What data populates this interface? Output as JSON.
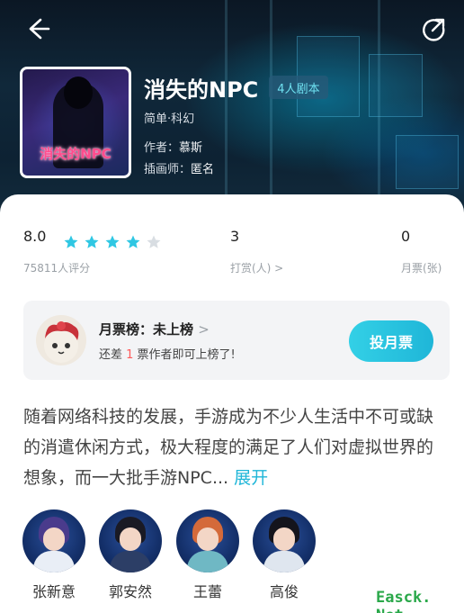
{
  "header": {
    "back_icon": "arrow-left-icon",
    "share_icon": "share-icon",
    "cover_title": "消失的NPC",
    "title": "消失的NPC",
    "tag": "4人剧本",
    "genre": "简单·科幻",
    "author_label": "作者：",
    "author": "慕斯",
    "illustrator_label": "插画师：",
    "illustrator": "匿名"
  },
  "stats": {
    "rating": "8.0",
    "stars_filled": 4,
    "stars_total": 5,
    "rating_count": "75811人评分",
    "tips": "3",
    "tips_label": "打赏(人) >",
    "tickets": "0",
    "tickets_label": "月票(张)"
  },
  "ticket_card": {
    "title": "月票榜：未上榜",
    "chevron": ">",
    "sub_prefix": "还差 ",
    "sub_num": "1",
    "sub_suffix": " 票作者即可上榜了!",
    "button": "投月票"
  },
  "description": {
    "text": "随着网络科技的发展，手游成为不少人生活中不可或缺的消遣休闲方式，极大程度的满足了人们对虚拟世界的想象，而一大批手游NPC... ",
    "expand": "展开"
  },
  "characters": [
    {
      "name": "张新意"
    },
    {
      "name": "郭安然"
    },
    {
      "name": "王蕾"
    },
    {
      "name": "高俊"
    }
  ],
  "watermark": "Easck. Net",
  "colors": {
    "accent": "#1fb6d8",
    "star": "#2fc7e3",
    "star_empty": "#d8dde2",
    "highlight_number": "#ff5a5a",
    "watermark": "#2aa84a"
  }
}
